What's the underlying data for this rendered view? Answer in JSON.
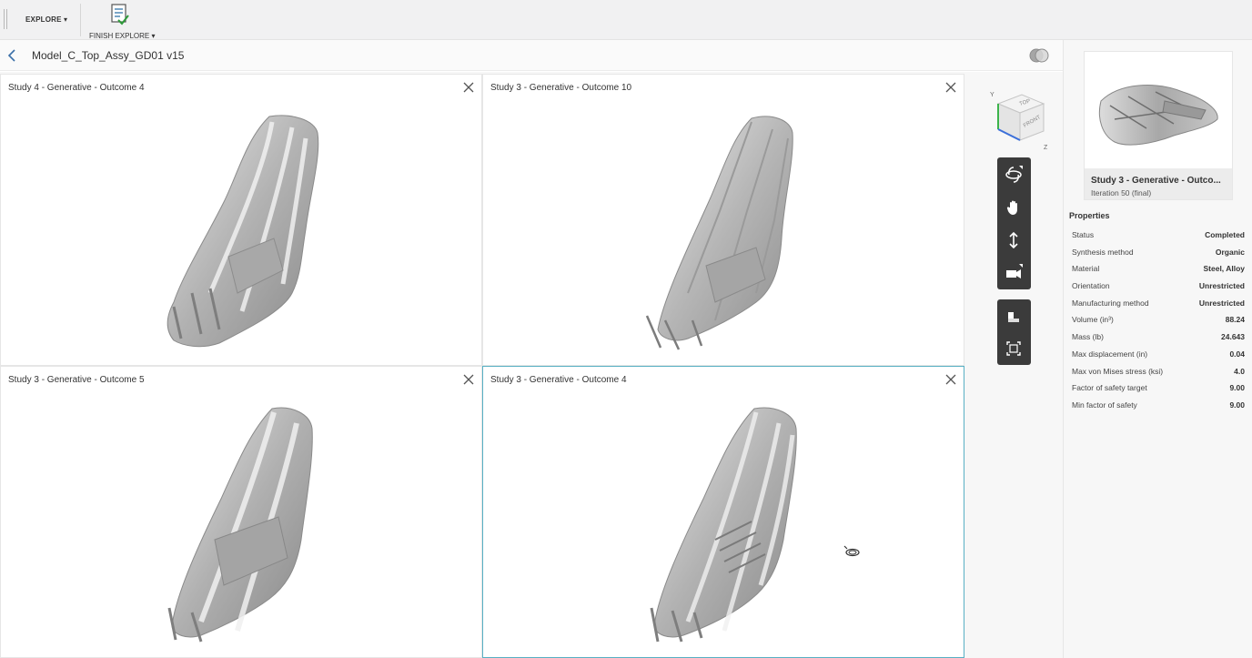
{
  "ribbon": {
    "explore_label": "EXPLORE ▾",
    "finish_label": "FINISH EXPLORE ▾"
  },
  "header": {
    "title": "Model_C_Top_Assy_GD01 v15"
  },
  "panes": [
    {
      "title": "Study 4 - Generative - Outcome 4",
      "selected": false
    },
    {
      "title": "Study 3 - Generative - Outcome 10",
      "selected": false
    },
    {
      "title": "Study 3 - Generative - Outcome 5",
      "selected": false
    },
    {
      "title": "Study 3 - Generative - Outcome 4",
      "selected": true
    }
  ],
  "viewcube": {
    "top": "TOP",
    "front": "FRONT",
    "axis_y": "Y",
    "axis_z": "Z"
  },
  "navbar_icons": [
    "orbit-icon",
    "pan-hand-icon",
    "zoom-icon",
    "camera-icon",
    "ground-shadow-icon",
    "fit-view-icon"
  ],
  "thumbnail": {
    "title": "Study 3 - Generative - Outco...",
    "subtitle": "Iteration 50 (final)"
  },
  "properties": {
    "heading": "Properties",
    "rows": [
      {
        "label": "Status",
        "value": "Completed"
      },
      {
        "label": "Synthesis method",
        "value": "Organic"
      },
      {
        "label": "Material",
        "value": "Steel, Alloy"
      },
      {
        "label": "Orientation",
        "value": "Unrestricted"
      },
      {
        "label": "Manufacturing method",
        "value": "Unrestricted"
      },
      {
        "label": "Volume (in³)",
        "value": "88.24"
      },
      {
        "label": "Mass (lb)",
        "value": "24.643"
      },
      {
        "label": "Max displacement (in)",
        "value": "0.04"
      },
      {
        "label": "Max von Mises stress (ksi)",
        "value": "4.0"
      },
      {
        "label": "Factor of safety target",
        "value": "9.00"
      },
      {
        "label": "Min factor of safety",
        "value": "9.00"
      }
    ]
  },
  "colors": {
    "selection_border": "#58b0c4",
    "toolbar_bg": "#3b3b3b",
    "model_gray": "#b4b4b4"
  }
}
